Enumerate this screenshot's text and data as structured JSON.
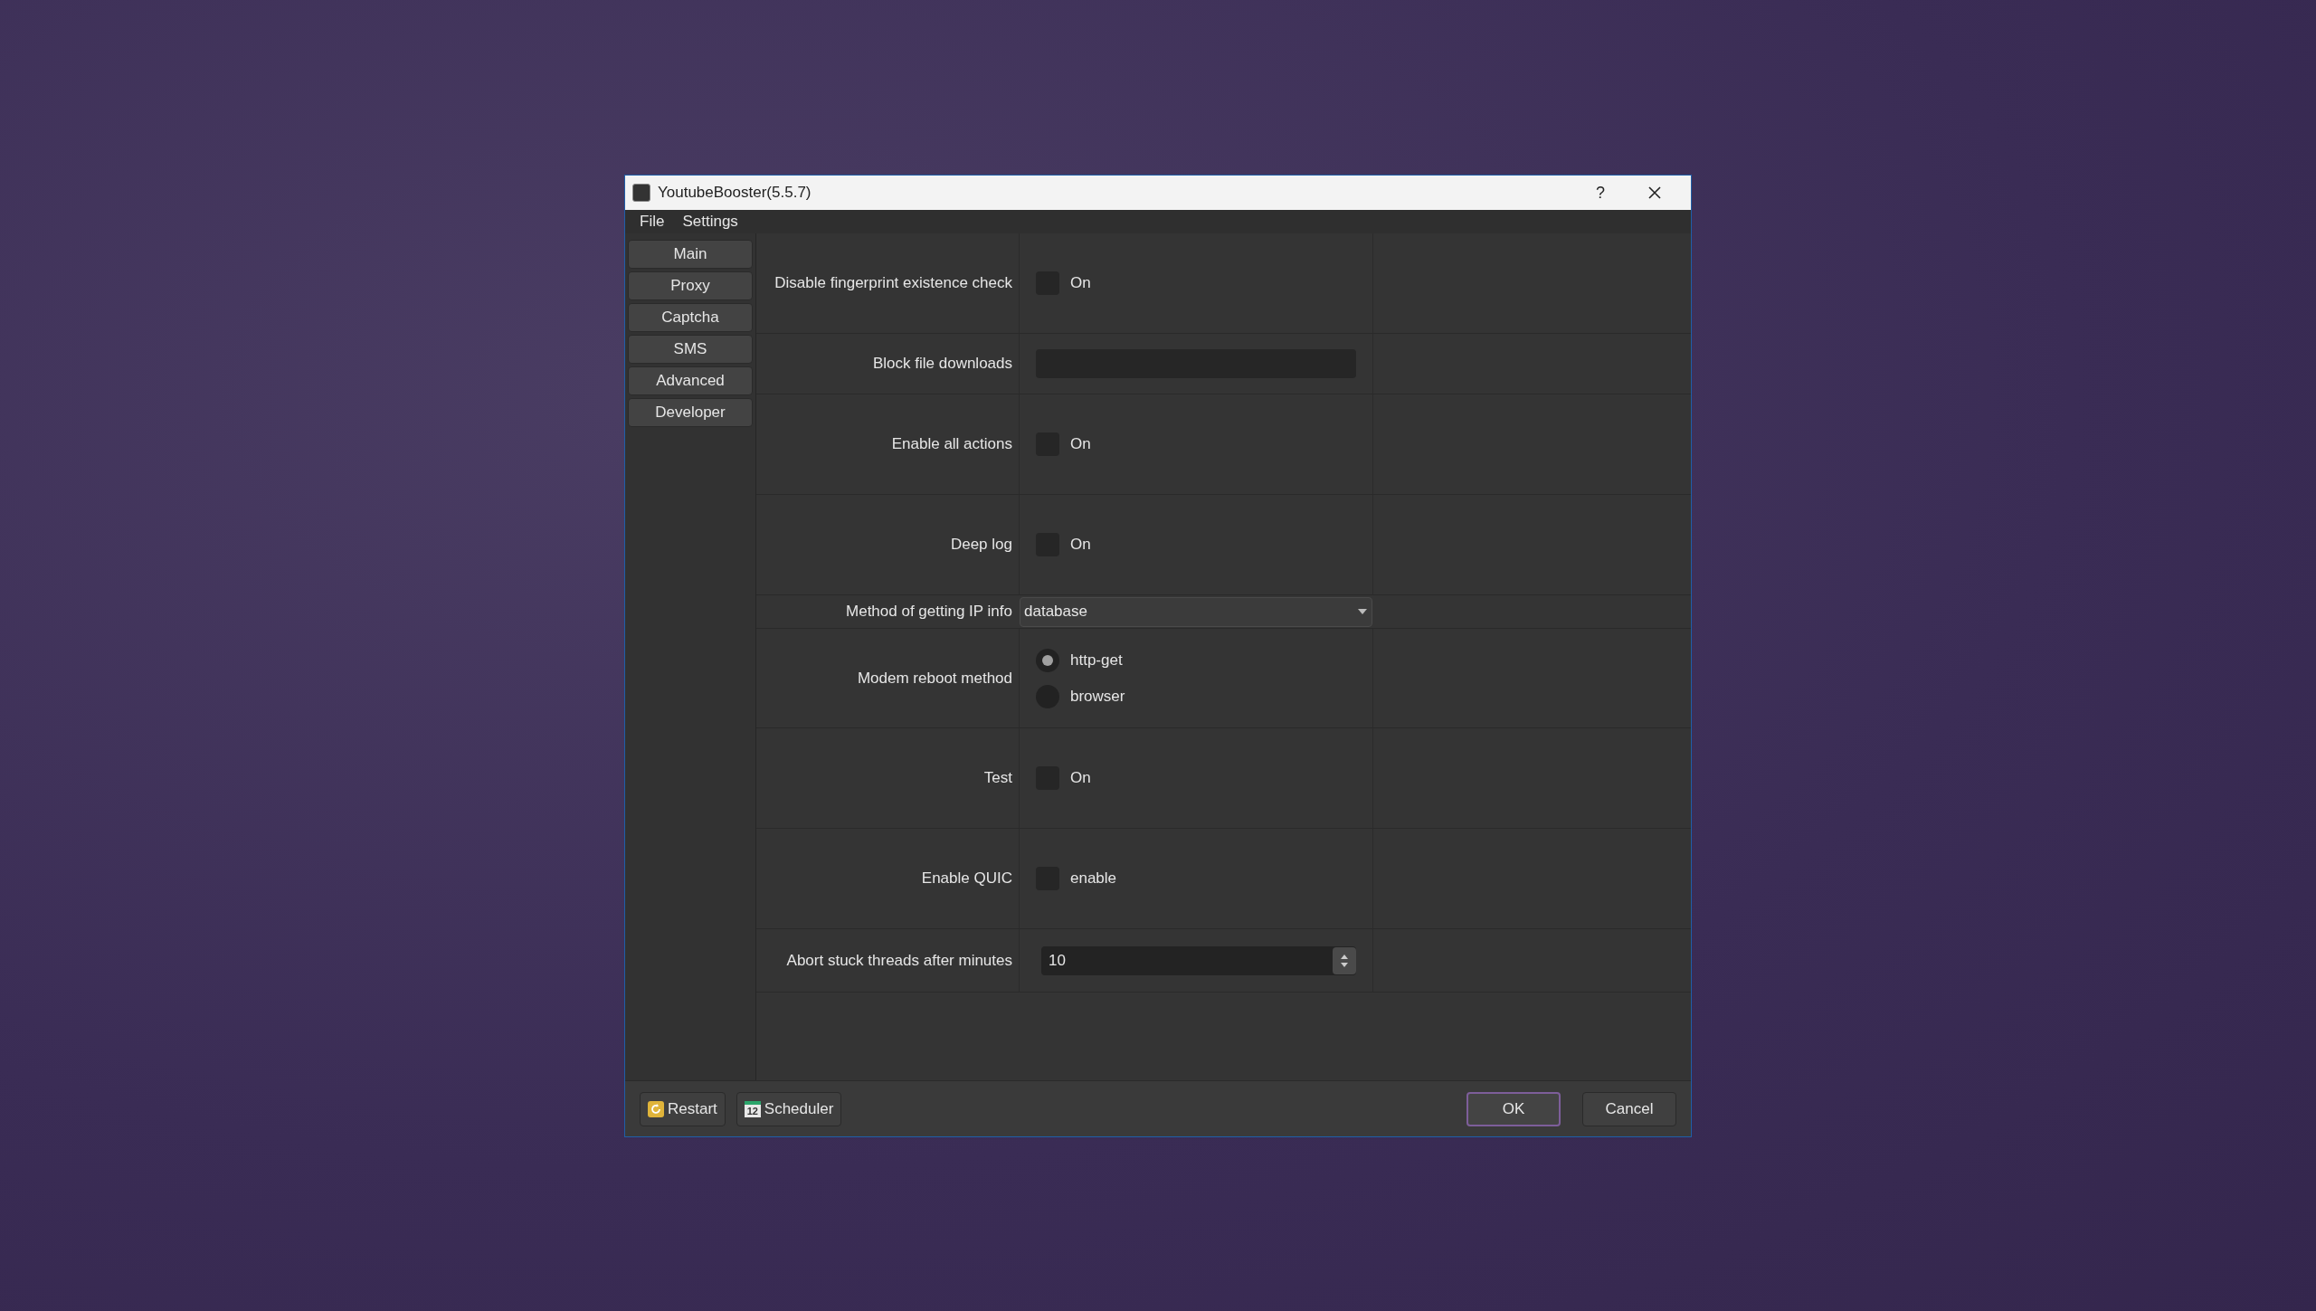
{
  "window": {
    "title": "YoutubeBooster(5.5.7)",
    "help": "?"
  },
  "menu": [
    "File",
    "Settings"
  ],
  "sidebar": [
    "Main",
    "Proxy",
    "Captcha",
    "SMS",
    "Advanced",
    "Developer"
  ],
  "settings": [
    {
      "kind": "checkbox",
      "label": "Disable fingerprint existence check",
      "text": "On",
      "checked": false
    },
    {
      "kind": "text",
      "label": "Block file downloads"
    },
    {
      "kind": "checkbox",
      "label": "Enable all actions",
      "text": "On",
      "checked": false
    },
    {
      "kind": "checkbox",
      "label": "Deep log",
      "text": "On",
      "checked": false
    },
    {
      "kind": "combo",
      "label": "Method of getting IP info",
      "value": "database"
    },
    {
      "kind": "radio",
      "label": "Modem reboot method",
      "options": [
        {
          "label": "http-get",
          "selected": true
        },
        {
          "label": "browser",
          "selected": false
        }
      ]
    },
    {
      "kind": "checkbox",
      "label": "Test",
      "text": "On",
      "checked": false
    },
    {
      "kind": "checkbox",
      "label": "Enable QUIC",
      "text": "enable",
      "checked": false
    },
    {
      "kind": "spin",
      "label": "Abort stuck threads after minutes",
      "value": "10"
    }
  ],
  "footer": {
    "left": [
      {
        "kind": "restart",
        "label": "Restart"
      },
      {
        "kind": "calendar",
        "label": "Scheduler",
        "icon_text": "12"
      }
    ],
    "ok": "OK",
    "cancel": "Cancel"
  }
}
